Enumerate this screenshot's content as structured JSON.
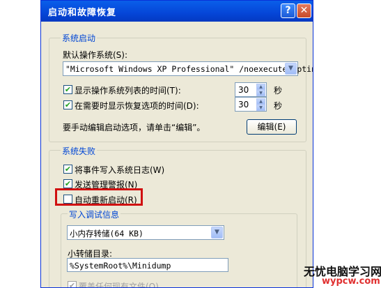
{
  "window": {
    "title": "启动和故障恢复",
    "help_button": "?",
    "close_button": "✕"
  },
  "startup": {
    "legend": "系统启动",
    "default_os_label": "默认操作系统(S):",
    "default_os_value": "\"Microsoft Windows XP Professional\" /noexecute=optin",
    "show_os_list_label": "显示操作系统列表的时间(T):",
    "show_os_list_value": "30",
    "show_recovery_label": "在需要时显示恢复选项的时间(D):",
    "show_recovery_value": "30",
    "seconds_unit": "秒",
    "manual_edit_text": "要手动编辑启动选项，请单击“编辑”。",
    "edit_button": "编辑(E)"
  },
  "failure": {
    "legend": "系统失败",
    "write_event_log": "将事件写入系统日志(W)",
    "send_alert": "发送管理警报(N)",
    "auto_restart": "自动重新启动(R)",
    "debug_legend": "写入调试信息",
    "debug_type": "小内存转储(64 KB)",
    "dump_dir_label": "小转储目录:",
    "dump_dir_value": "%SystemRoot%\\Minidump",
    "overwrite_label": "覆盖任何现有文件(O)"
  },
  "watermark": {
    "line1": "无忧电脑学习网",
    "line2": "wypcw.com"
  },
  "checkbox_states": {
    "show_os_list": true,
    "show_recovery": true,
    "write_event_log": true,
    "send_alert": true,
    "auto_restart": false,
    "overwrite": true
  },
  "colors": {
    "highlight": "#d01010",
    "titlebar": "#0546d8"
  }
}
